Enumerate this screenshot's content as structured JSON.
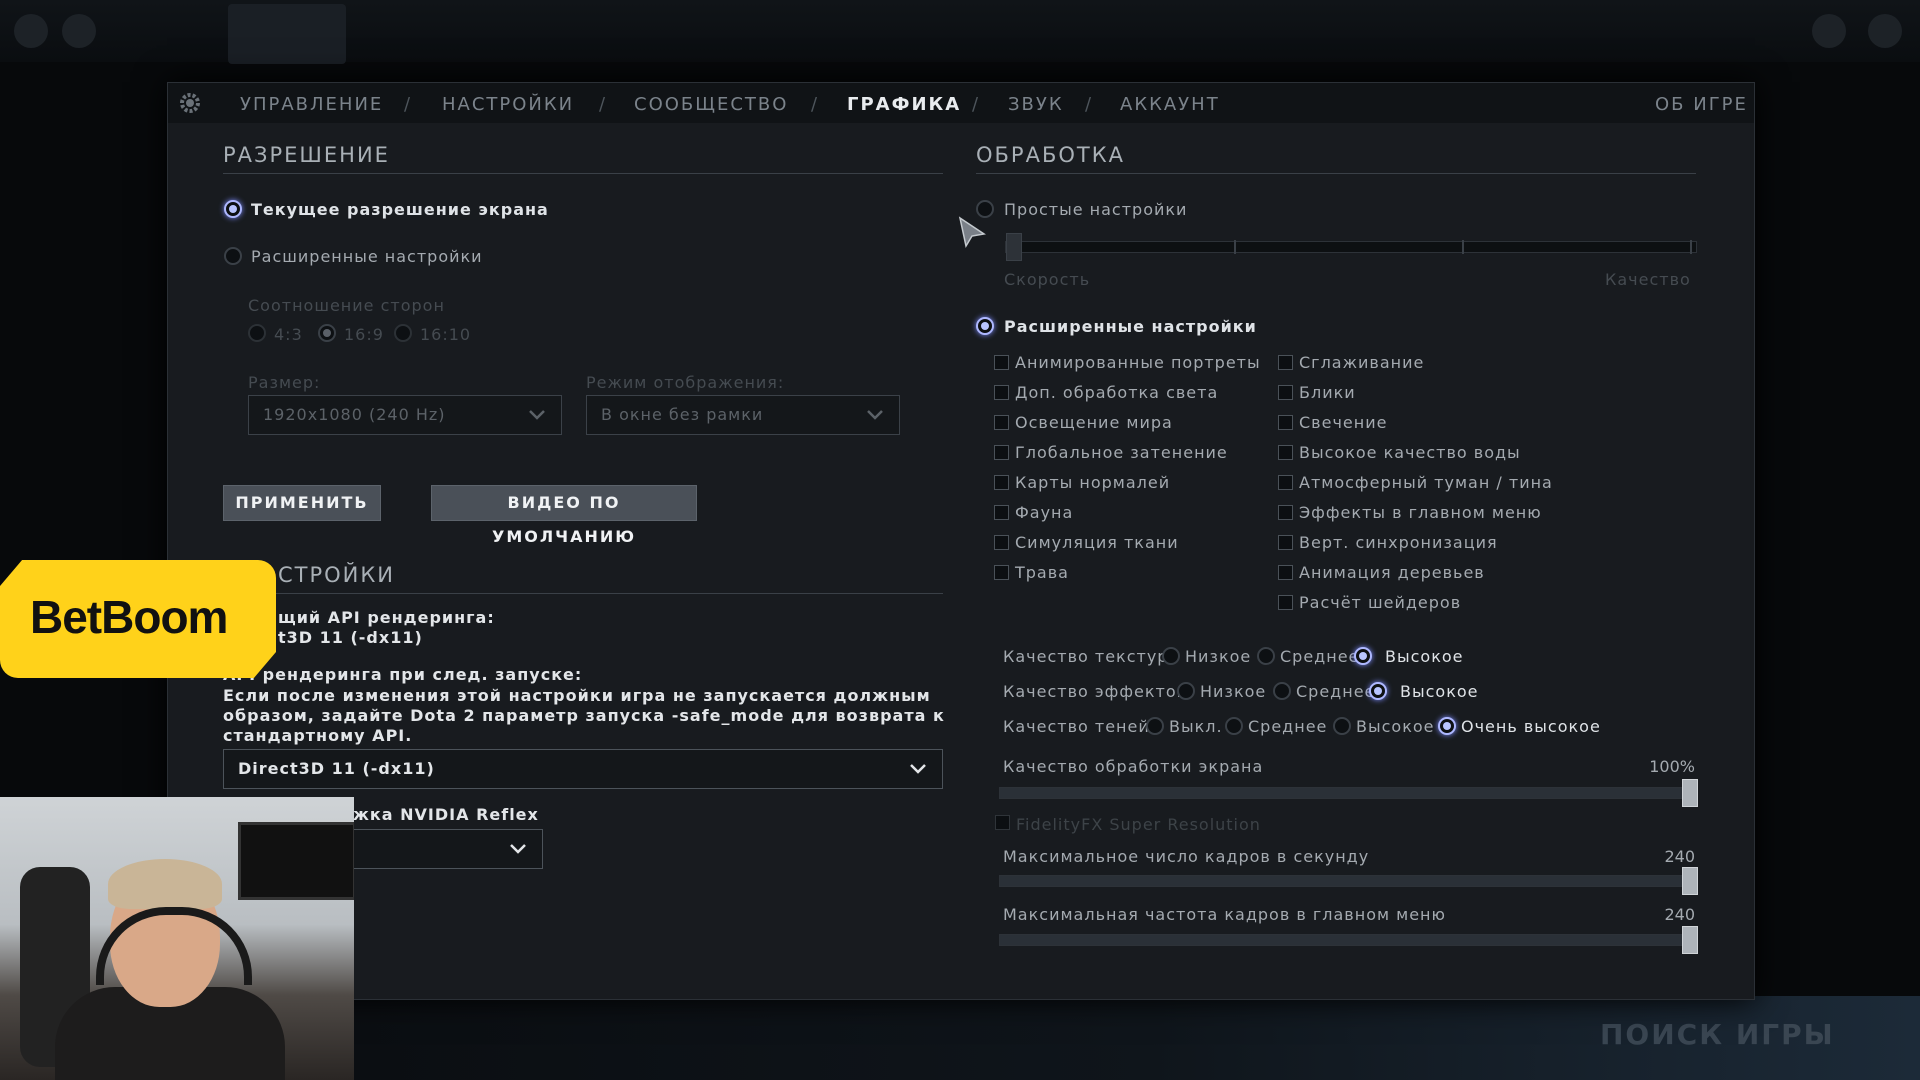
{
  "header": {
    "tabs": [
      "УПРАВЛЕНИЕ",
      "НАСТРОЙКИ",
      "СООБЩЕСТВО",
      "ГРАФИКА",
      "ЗВУК",
      "АККАУНТ"
    ],
    "active_tab": "ГРАФИКА",
    "about": "ОБ ИГРЕ"
  },
  "resolution": {
    "title": "РАЗРЕШЕНИЕ",
    "current_label": "Текущее разрешение экрана",
    "advanced_label": "Расширенные настройки",
    "aspect_label": "Соотношение сторон",
    "aspect_options": [
      "4:3",
      "16:9",
      "16:10"
    ],
    "aspect_selected": "16:9",
    "size_label": "Размер:",
    "size_value": "1920x1080 (240 Hz)",
    "display_label": "Режим отображения:",
    "display_value": "В окне без рамки",
    "apply_button": "ПРИМЕНИТЬ",
    "default_button": "ВИДЕО ПО УМОЛЧАНИЮ"
  },
  "render": {
    "title": "СТРОЙКИ",
    "current_api_label": "щий API рендеринга:",
    "current_api_value": "t3D 11 (-dx11)",
    "next_api_label": "API рендеринга при след. запуске:",
    "warning_line1": "Если после изменения этой настройки игра не запускается должным",
    "warning_line2": "образом, задайте Dota 2 параметр запуска -safe_mode для возврата к",
    "warning_line3": "стандартному API.",
    "api_select_value": "Direct3D 11 (-dx11)",
    "reflex_label": "жка NVIDIA Reflex"
  },
  "processing": {
    "title": "ОБРАБОТКА",
    "simple_label": "Простые настройки",
    "speed_label": "Скорость",
    "quality_label": "Качество",
    "simple_slider_level": 0,
    "advanced_label": "Расширенные настройки",
    "checkboxes_left": [
      "Анимированные портреты",
      "Доп. обработка света",
      "Освещение мира",
      "Глобальное затенение",
      "Карты нормалей",
      "Фауна",
      "Симуляция ткани",
      "Трава"
    ],
    "checkboxes_right": [
      "Сглаживание",
      "Блики",
      "Свечение",
      "Высокое качество воды",
      "Атмосферный туман / тина",
      "Эффекты в главном меню",
      "Верт. синхронизация",
      "Анимация деревьев",
      "Расчёт шейдеров"
    ],
    "texture_label": "Качество текстур",
    "texture_options": [
      "Низкое",
      "Среднее",
      "Высокое"
    ],
    "texture_selected": "Высокое",
    "effects_label": "Качество эффектов",
    "effects_options": [
      "Низкое",
      "Среднее",
      "Высокое"
    ],
    "effects_selected": "Высокое",
    "shadows_label": "Качество теней",
    "shadows_options": [
      "Выкл.",
      "Среднее",
      "Высокое",
      "Очень высокое"
    ],
    "shadows_selected": "Очень высокое",
    "screen_quality_label": "Качество обработки экрана",
    "screen_quality_value": "100%",
    "screen_quality_level": 1.0,
    "fsr_label": "FidelityFX Super Resolution",
    "max_fps_label": "Максимальное число кадров в секунду",
    "max_fps_value": "240",
    "max_fps_level": 1.0,
    "menu_fps_label": "Максимальная частота кадров в главном меню",
    "menu_fps_value": "240",
    "menu_fps_level": 1.0
  },
  "overlay": {
    "sponsor": "BetBoom",
    "find_game": "ПОИСК ИГРЫ"
  },
  "colors": {
    "panel_bg": "#181b1f",
    "radio_active": "#b8c4ff",
    "sponsor_yellow": "#ffd21a"
  }
}
